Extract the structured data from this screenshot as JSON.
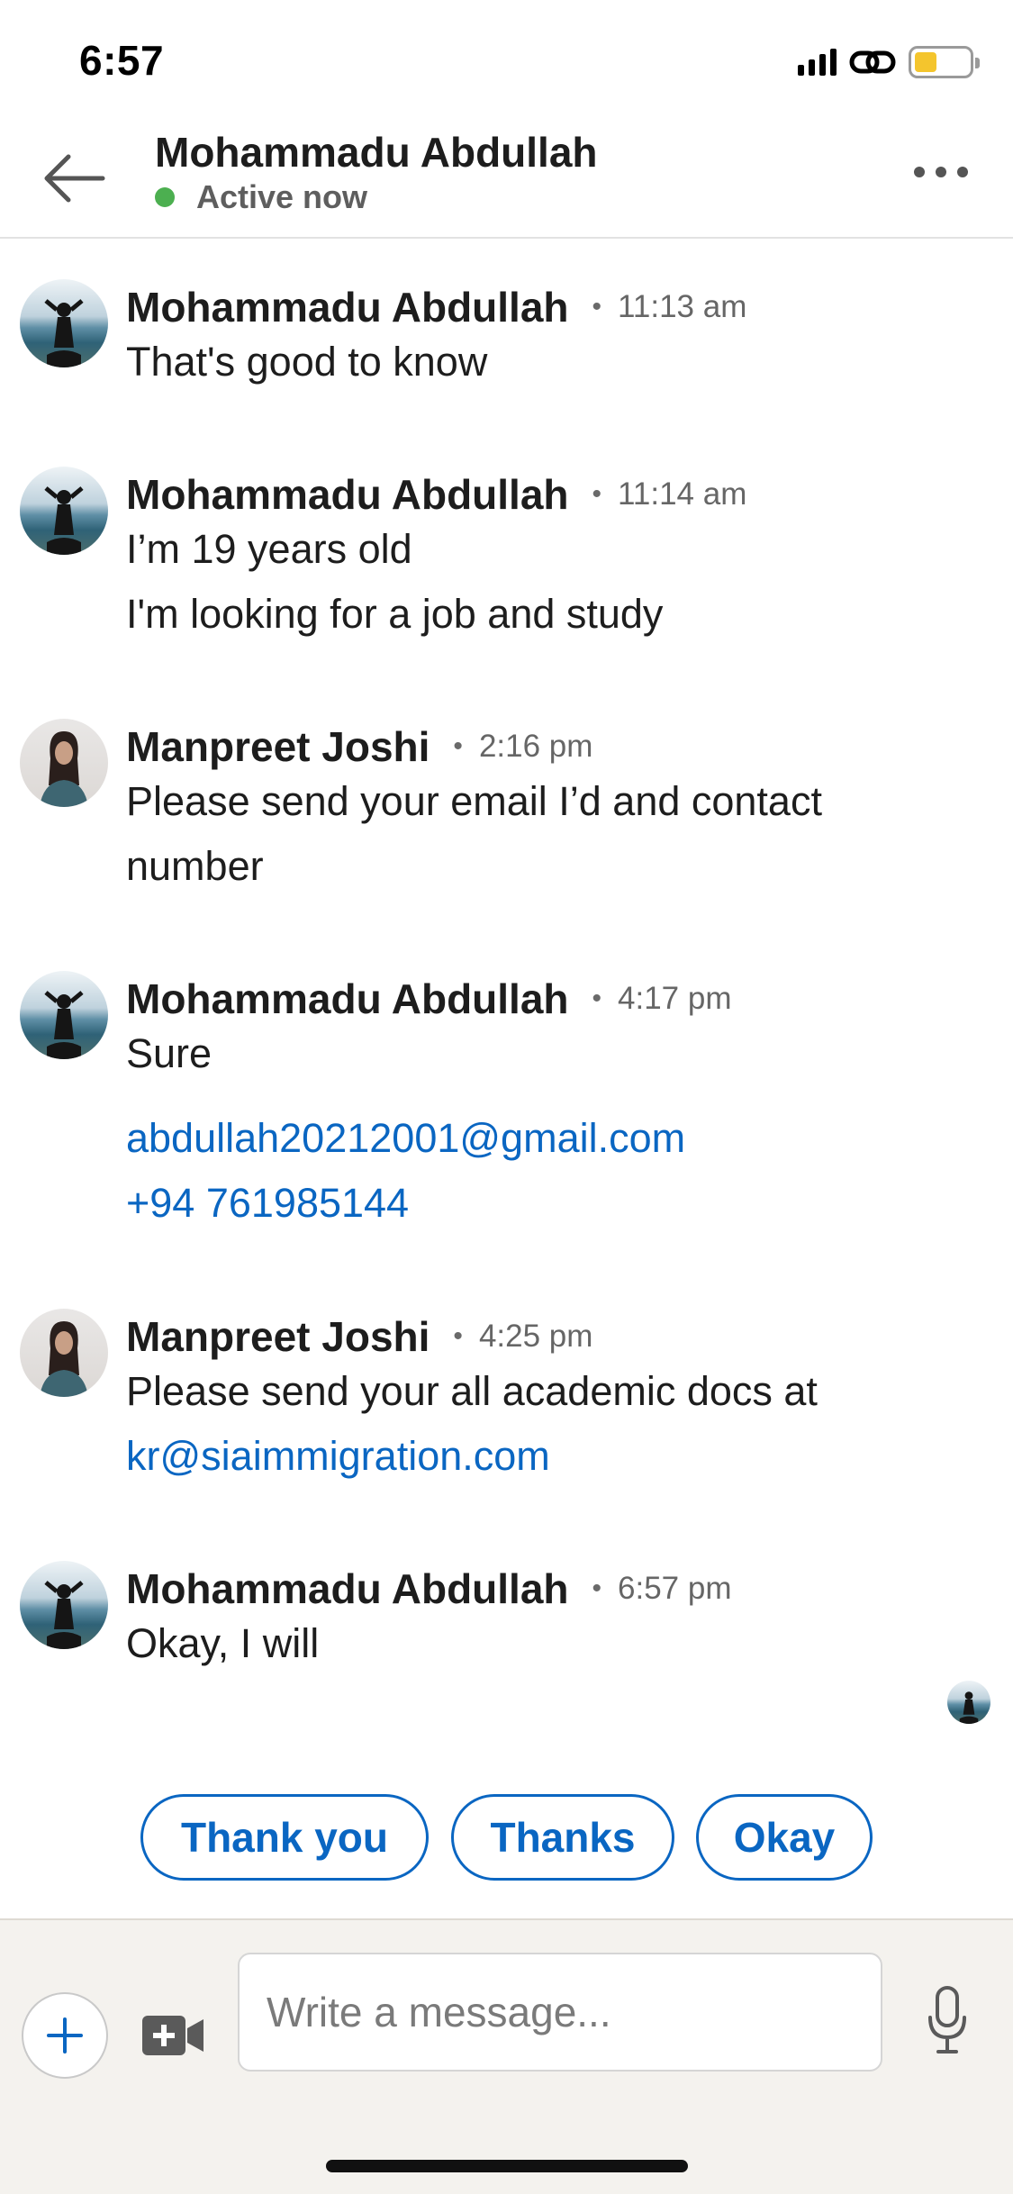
{
  "status_bar": {
    "time": "6:57"
  },
  "header": {
    "contact_name": "Mohammadu Abdullah",
    "presence": "Active now",
    "presence_color": "#4caf50"
  },
  "messages": [
    {
      "sender": "Mohammadu Abdullah",
      "time": "11:13 am",
      "lines": [
        "That's good to know"
      ]
    },
    {
      "sender": "Mohammadu Abdullah",
      "time": "11:14 am",
      "lines": [
        "I’m 19 years old",
        "I'm looking for a job and study"
      ]
    },
    {
      "sender": "Manpreet Joshi",
      "time": "2:16 pm",
      "lines": [
        "Please send your email I’d and contact",
        "number"
      ]
    },
    {
      "sender": "Mohammadu Abdullah",
      "time": "4:17 pm",
      "lines": [
        "Sure",
        "abdullah20212001@gmail.com",
        "+94 761985144"
      ]
    },
    {
      "sender": "Manpreet Joshi",
      "time": "4:25 pm",
      "lines": [
        "Please send your all academic docs at",
        "kr@siaimmigration.com"
      ]
    },
    {
      "sender": "Mohammadu Abdullah",
      "time": "6:57 pm",
      "lines": [
        "Okay, I will"
      ]
    }
  ],
  "quick_replies": [
    "Thank you",
    "Thanks",
    "Okay"
  ],
  "composer": {
    "placeholder": "Write a message..."
  },
  "icons": {
    "back": "arrow-left-icon",
    "more": "more-horizontal-icon",
    "add": "plus-icon",
    "video": "video-camera-icon",
    "mic": "microphone-icon"
  },
  "colors": {
    "link": "#0a66c2",
    "accent": "#0a66c2",
    "composer_bg": "#f4f2ee"
  }
}
